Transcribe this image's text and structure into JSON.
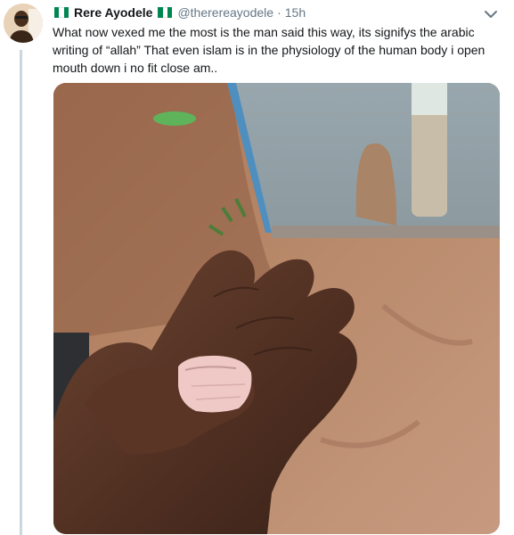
{
  "tweet": {
    "author_name": "Rere Ayodele",
    "handle": "@therereayodele",
    "separator": "·",
    "time": "15h",
    "text": "What now vexed me the most is the man said this way, its signifys the arabic writing of “allah” That even islam is in the physiology of the human body i open mouth down i no fit close am..",
    "flag_colors": [
      "#008751",
      "#ffffff",
      "#008751"
    ]
  },
  "icons": {
    "author_flag_before": "nigeria-flag-icon",
    "author_flag_after": "nigeria-flag-icon",
    "more_options": "chevron-down-icon"
  },
  "colors": {
    "text": "#14171a",
    "secondary": "#657786",
    "thread_line": "#ccd6dd"
  }
}
